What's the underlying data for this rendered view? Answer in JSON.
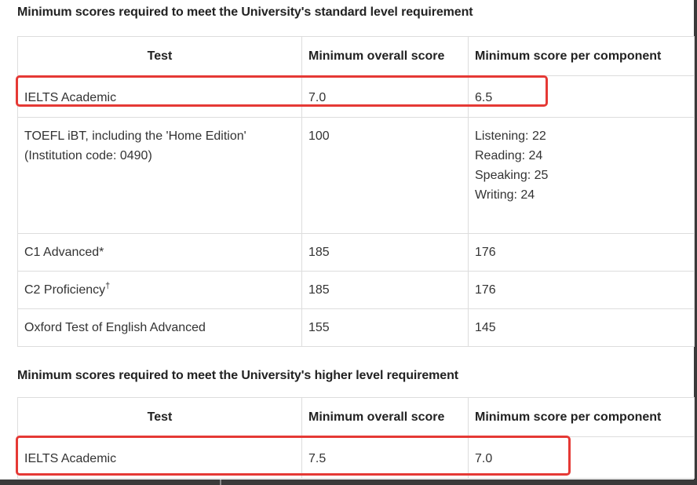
{
  "table1": {
    "caption": "Minimum scores required to meet the University's standard level requirement",
    "headers": [
      "Test",
      "Minimum overall score",
      "Minimum score per component"
    ],
    "rows": [
      {
        "test": "IELTS Academic",
        "overall": "7.0",
        "component": [
          "6.5"
        ]
      },
      {
        "test": [
          "TOEFL iBT, including the 'Home Edition'",
          "(Institution code: 0490)"
        ],
        "overall": "100",
        "component": [
          "Listening: 22",
          "Reading: 24",
          "Speaking: 25",
          "Writing: 24"
        ]
      },
      {
        "test": "C1 Advanced*",
        "overall": "185",
        "component": [
          "176"
        ]
      },
      {
        "test": "C2 Proficiency",
        "test_sup": "†",
        "overall": "185",
        "component": [
          "176"
        ]
      },
      {
        "test": "Oxford Test of English Advanced",
        "overall": "155",
        "component": [
          "145"
        ]
      }
    ]
  },
  "table2": {
    "caption": "Minimum scores required to meet the University's higher level requirement",
    "headers": [
      "Test",
      "Minimum overall score",
      "Minimum score per component"
    ],
    "rows": [
      {
        "test": "IELTS Academic",
        "overall": "7.5",
        "component": [
          "7.0"
        ]
      }
    ]
  },
  "colors": {
    "highlight": "#e53935",
    "border": "#dddddd",
    "text": "#333333"
  }
}
